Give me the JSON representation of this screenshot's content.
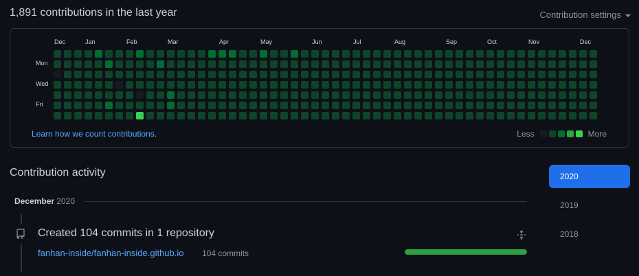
{
  "header": {
    "title": "1,891 contributions in the last year",
    "settings_label": "Contribution settings"
  },
  "calendar": {
    "months": [
      {
        "label": "Dec",
        "week": 0
      },
      {
        "label": "Jan",
        "week": 3
      },
      {
        "label": "Feb",
        "week": 7
      },
      {
        "label": "Mar",
        "week": 11
      },
      {
        "label": "Apr",
        "week": 16
      },
      {
        "label": "May",
        "week": 20
      },
      {
        "label": "Jun",
        "week": 25
      },
      {
        "label": "Jul",
        "week": 29
      },
      {
        "label": "Aug",
        "week": 33
      },
      {
        "label": "Sep",
        "week": 38
      },
      {
        "label": "Oct",
        "week": 42
      },
      {
        "label": "Nov",
        "week": 46
      },
      {
        "label": "Dec",
        "week": 51
      }
    ],
    "day_labels": [
      {
        "label": "Mon",
        "row": 1
      },
      {
        "label": "Wed",
        "row": 3
      },
      {
        "label": "Fri",
        "row": 5
      }
    ],
    "colors": [
      "#161b22",
      "#0e4429",
      "#006d32",
      "#26a641",
      "#39d353"
    ],
    "weeks": [
      [
        1,
        1,
        0,
        1,
        1,
        1,
        1
      ],
      [
        1,
        1,
        1,
        1,
        1,
        1,
        1
      ],
      [
        1,
        1,
        1,
        1,
        1,
        1,
        1
      ],
      [
        1,
        1,
        1,
        1,
        1,
        1,
        1
      ],
      [
        2,
        1,
        1,
        1,
        1,
        1,
        1
      ],
      [
        1,
        2,
        1,
        1,
        1,
        2,
        1
      ],
      [
        1,
        1,
        1,
        0,
        1,
        1,
        1
      ],
      [
        1,
        1,
        1,
        1,
        1,
        1,
        1
      ],
      [
        2,
        1,
        1,
        1,
        0,
        1,
        4
      ],
      [
        1,
        1,
        1,
        1,
        1,
        1,
        1
      ],
      [
        1,
        2,
        1,
        1,
        1,
        1,
        1
      ],
      [
        1,
        1,
        1,
        1,
        2,
        2,
        1
      ],
      [
        1,
        1,
        1,
        1,
        1,
        1,
        1
      ],
      [
        1,
        1,
        1,
        1,
        1,
        1,
        1
      ],
      [
        1,
        1,
        1,
        1,
        1,
        1,
        1
      ],
      [
        2,
        1,
        1,
        1,
        1,
        1,
        1
      ],
      [
        2,
        1,
        1,
        1,
        1,
        1,
        1
      ],
      [
        2,
        1,
        1,
        1,
        1,
        1,
        1
      ],
      [
        1,
        1,
        1,
        1,
        1,
        1,
        1
      ],
      [
        1,
        1,
        1,
        1,
        1,
        1,
        1
      ],
      [
        2,
        1,
        1,
        1,
        1,
        1,
        1
      ],
      [
        1,
        1,
        1,
        1,
        1,
        1,
        1
      ],
      [
        1,
        1,
        1,
        1,
        1,
        1,
        1
      ],
      [
        2,
        1,
        1,
        1,
        1,
        1,
        1
      ],
      [
        1,
        1,
        1,
        1,
        1,
        1,
        1
      ],
      [
        1,
        1,
        1,
        1,
        1,
        1,
        1
      ],
      [
        1,
        1,
        1,
        1,
        1,
        1,
        1
      ],
      [
        1,
        1,
        1,
        1,
        1,
        1,
        1
      ],
      [
        1,
        1,
        1,
        1,
        1,
        1,
        1
      ],
      [
        1,
        1,
        1,
        1,
        1,
        1,
        1
      ],
      [
        1,
        1,
        1,
        1,
        1,
        1,
        1
      ],
      [
        1,
        1,
        1,
        1,
        1,
        1,
        1
      ],
      [
        1,
        1,
        1,
        1,
        1,
        1,
        1
      ],
      [
        1,
        1,
        1,
        1,
        1,
        1,
        1
      ],
      [
        1,
        1,
        1,
        1,
        1,
        1,
        1
      ],
      [
        1,
        1,
        1,
        1,
        1,
        1,
        1
      ],
      [
        1,
        1,
        1,
        1,
        1,
        1,
        1
      ],
      [
        1,
        1,
        1,
        1,
        1,
        1,
        1
      ],
      [
        1,
        1,
        1,
        1,
        1,
        1,
        1
      ],
      [
        1,
        1,
        1,
        1,
        1,
        1,
        1
      ],
      [
        1,
        1,
        1,
        1,
        1,
        1,
        1
      ],
      [
        1,
        1,
        1,
        1,
        1,
        1,
        1
      ],
      [
        1,
        1,
        1,
        1,
        1,
        1,
        1
      ],
      [
        1,
        1,
        1,
        1,
        1,
        1,
        1
      ],
      [
        1,
        1,
        1,
        1,
        1,
        1,
        1
      ],
      [
        1,
        1,
        1,
        1,
        1,
        1,
        1
      ],
      [
        1,
        1,
        1,
        1,
        1,
        1,
        1
      ],
      [
        1,
        1,
        1,
        1,
        1,
        1,
        1
      ],
      [
        1,
        1,
        1,
        1,
        1,
        1,
        1
      ],
      [
        1,
        1,
        1,
        1,
        1,
        1,
        1
      ],
      [
        1,
        1,
        1,
        1,
        1,
        1,
        1
      ],
      [
        1,
        1,
        1,
        1,
        1,
        1,
        1
      ],
      [
        1,
        1,
        1,
        1,
        1,
        1,
        1
      ]
    ],
    "learn_link": "Learn how we count contributions.",
    "legend_less": "Less",
    "legend_more": "More"
  },
  "activity": {
    "title": "Contribution activity",
    "month_label": "December",
    "month_year": "2020",
    "event_title": "Created 104 commits in 1 repository",
    "repo_name": "fanhan-inside/fanhan-inside.github.io",
    "repo_commits": "104 commits",
    "progress": 1.0
  },
  "years": [
    "2020",
    "2019",
    "2018"
  ],
  "accent": "#1f6feb"
}
